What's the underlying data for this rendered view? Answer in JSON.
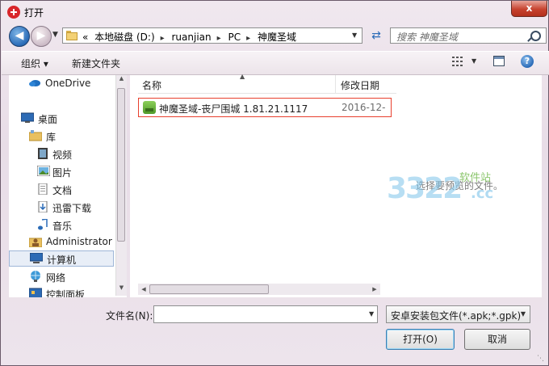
{
  "window": {
    "title": "打开",
    "close_glyph": "x"
  },
  "nav": {
    "breadcrumbs": [
      "«",
      "本地磁盘 (D:)",
      "ruanjian",
      "PC",
      "神魔圣域"
    ],
    "search_placeholder": "搜索 神魔圣域"
  },
  "toolbar": {
    "organize_label": "组织 ▾",
    "new_folder_label": "新建文件夹",
    "help_glyph": "?"
  },
  "sidebar": {
    "items": [
      {
        "label": "OneDrive",
        "icon": "cloud-icon"
      },
      {
        "label": "桌面",
        "icon": "desktop-icon"
      },
      {
        "label": "库",
        "icon": "library-icon"
      },
      {
        "label": "视频",
        "icon": "video-icon"
      },
      {
        "label": "图片",
        "icon": "picture-icon"
      },
      {
        "label": "文档",
        "icon": "document-icon"
      },
      {
        "label": "迅雷下载",
        "icon": "download-icon"
      },
      {
        "label": "音乐",
        "icon": "music-icon"
      },
      {
        "label": "Administrator",
        "icon": "user-folder-icon"
      },
      {
        "label": "计算机",
        "icon": "computer-icon",
        "selected": true
      },
      {
        "label": "网络",
        "icon": "network-icon"
      },
      {
        "label": "控制面板",
        "icon": "control-panel-icon"
      }
    ]
  },
  "file_list": {
    "columns": [
      "名称",
      "修改日期"
    ],
    "files": [
      {
        "name": "神魔圣域-丧尸围城 1.81.21.1117",
        "modified": "2016-12-"
      }
    ],
    "empty_message": "选择要预览的文件。"
  },
  "watermark": {
    "number": "3322",
    "text": "软件站",
    "domain": ".cc"
  },
  "bottom": {
    "filename_label": "文件名(N):",
    "filename_value": "",
    "filetype_value": "安卓安装包文件(*.apk;*.gpk)",
    "open_label": "打开(O)",
    "cancel_label": "取消"
  }
}
